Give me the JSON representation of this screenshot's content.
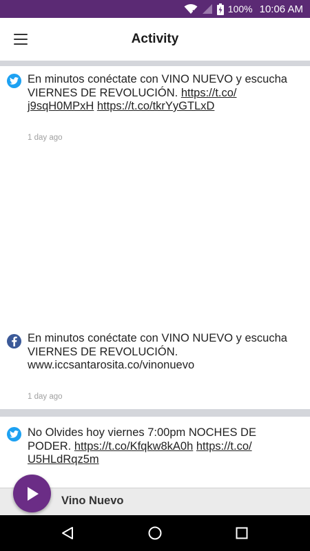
{
  "status_bar": {
    "battery_percent": "100%",
    "time": "10:06 AM",
    "background_color": "#5b2a74",
    "icons": [
      "wifi-icon",
      "signal-icon",
      "battery-charging-icon"
    ]
  },
  "app_bar": {
    "title": "Activity",
    "menu_icon": "hamburger-menu-icon"
  },
  "feed": {
    "posts": [
      {
        "source": "twitter",
        "icon": "twitter-icon",
        "text": "En minutos conéctate con VINO NUEVO y escucha VIERNES DE REVOLUCIÓN. ",
        "link1_a": "https://t.co/",
        "link1_b": "j9sqH0MPxH",
        "link2": "https://t.co/tkrYyGTLxD",
        "time": "1 day ago"
      },
      {
        "source": "facebook",
        "icon": "facebook-icon",
        "line1": "En minutos conéctate con VINO NUEVO y escucha",
        "line2": "VIERNES DE REVOLUCIÓN.",
        "line3": "www.iccsantarosita.co/vinonuevo",
        "time": "1 day ago"
      },
      {
        "source": "twitter",
        "icon": "twitter-icon",
        "line1": "No Olvides hoy viernes 7:00pm NOCHES DE",
        "line2_text": "PODER. ",
        "link1": "https://t.co/Kfqkw8kA0h",
        "link2_a": "https://t.co/",
        "link2_b": "U5HLdRqz5m"
      }
    ]
  },
  "player": {
    "station_name": "Vino Nuevo",
    "play_icon": "play-icon",
    "accent_color": "#6b2d86"
  },
  "nav_bar": {
    "buttons": [
      "back-icon",
      "home-icon",
      "recents-icon"
    ]
  }
}
